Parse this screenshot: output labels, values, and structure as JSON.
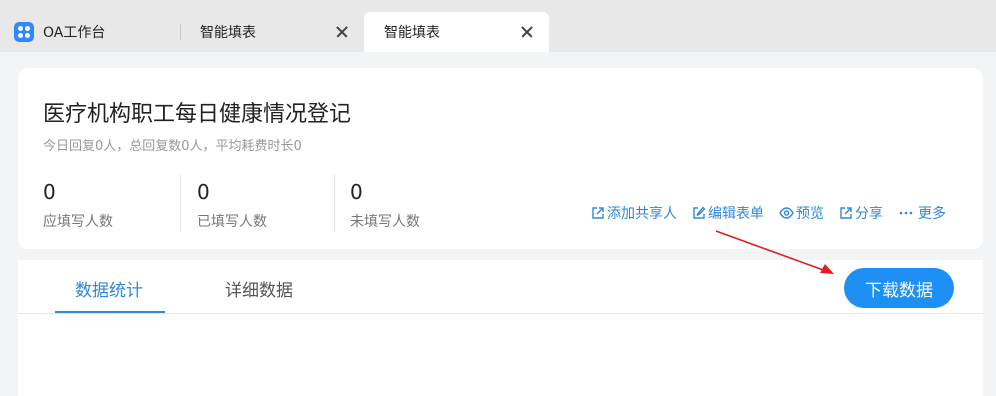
{
  "tabs": [
    {
      "label": "OA工作台",
      "icon": "app-grid-icon"
    },
    {
      "label": "智能填表",
      "closable": true
    },
    {
      "label": "智能填表",
      "closable": true,
      "active": true
    }
  ],
  "form": {
    "title": "医疗机构职工每日健康情况登记",
    "subtitle": "今日回复0人，总回复数0人，平均耗费时长0"
  },
  "stats": [
    {
      "value": "0",
      "label": "应填写人数"
    },
    {
      "value": "0",
      "label": "已填写人数"
    },
    {
      "value": "0",
      "label": "未填写人数"
    }
  ],
  "actions": [
    {
      "label": "添加共享人",
      "icon": "external-link-icon"
    },
    {
      "label": "编辑表单",
      "icon": "edit-icon"
    },
    {
      "label": "预览",
      "icon": "eye-icon"
    },
    {
      "label": "分享",
      "icon": "share-icon"
    },
    {
      "label": "更多",
      "icon": "ellipsis-icon"
    }
  ],
  "data_tabs": [
    {
      "label": "数据统计",
      "selected": true
    },
    {
      "label": "详细数据",
      "selected": false
    }
  ],
  "download_button": "下载数据",
  "colors": {
    "accent": "#2f88d9",
    "button": "#1e90f5",
    "arrow": "#e02020"
  }
}
